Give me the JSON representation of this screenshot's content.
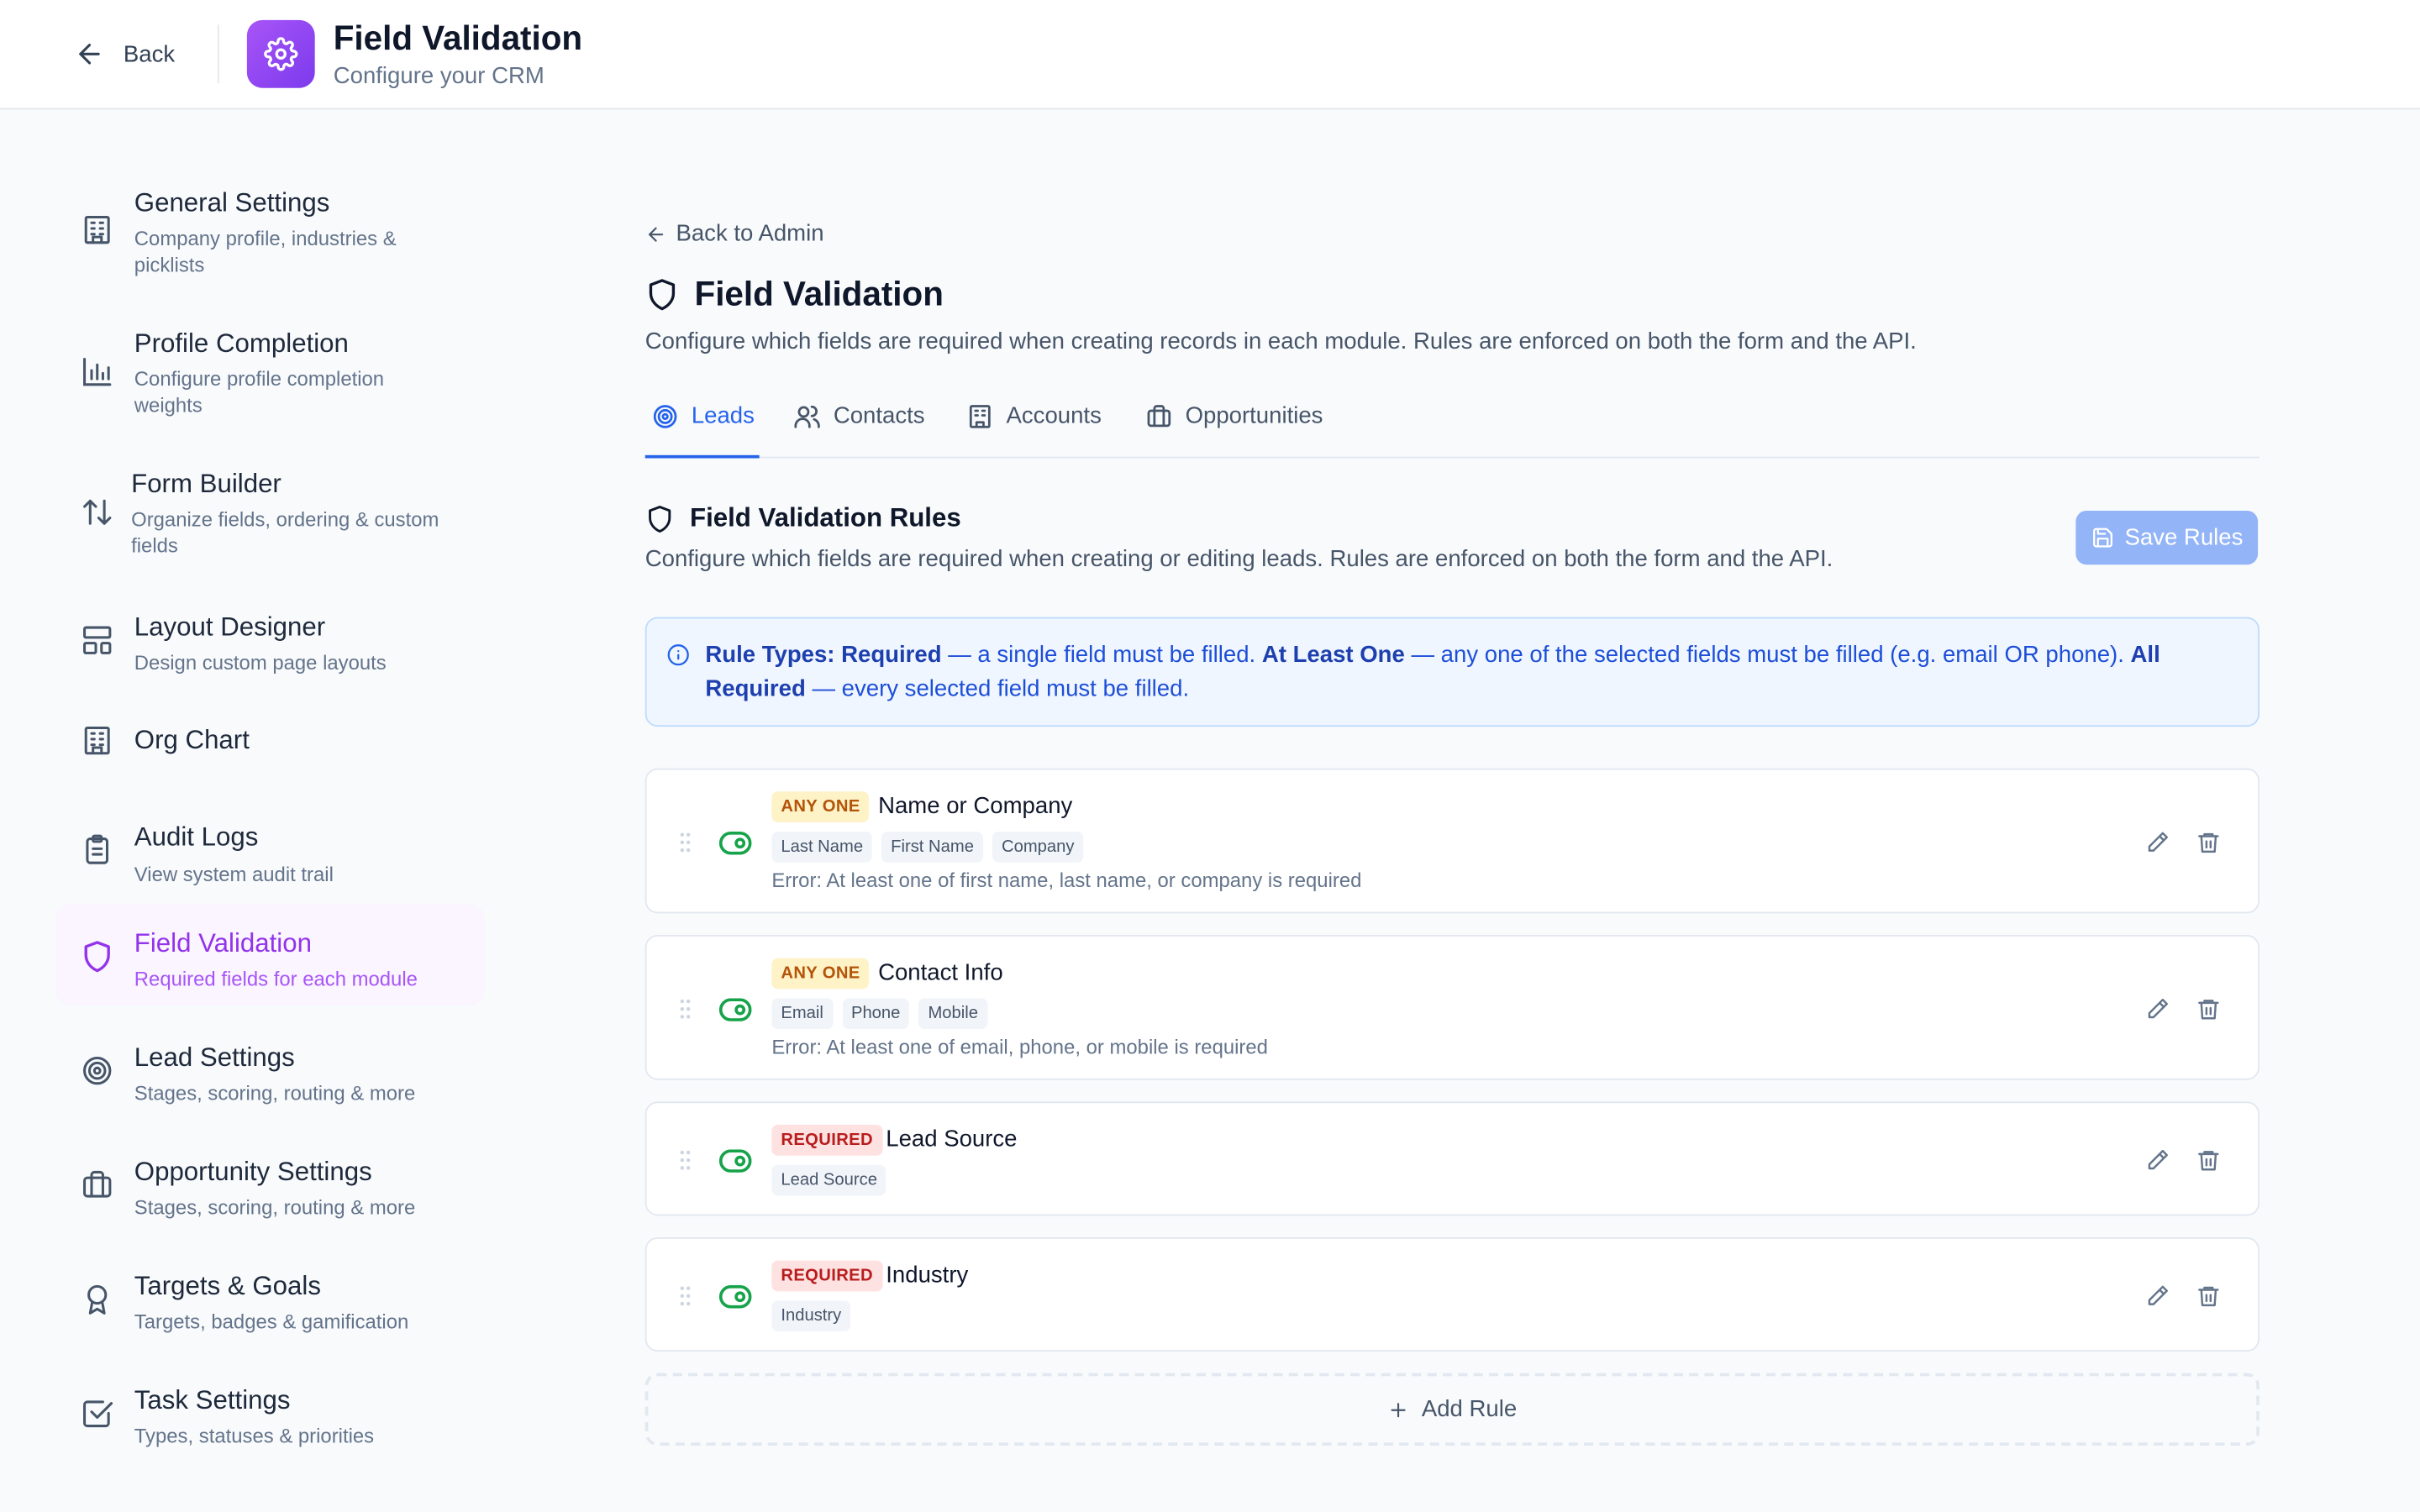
{
  "header": {
    "back_label": "Back",
    "title": "Field Validation",
    "subtitle": "Configure your CRM",
    "icon": "gear-icon"
  },
  "sidebar": {
    "items": [
      {
        "label": "General Settings",
        "desc": "Company profile, industries & picklists",
        "icon": "building-icon"
      },
      {
        "label": "Profile Completion",
        "desc": "Configure profile completion weights",
        "icon": "bar-chart-icon"
      },
      {
        "label": "Form Builder",
        "desc": "Organize fields, ordering & custom fields",
        "icon": "sort-arrows-icon"
      },
      {
        "label": "Layout Designer",
        "desc": "Design custom page layouts",
        "icon": "layout-icon"
      },
      {
        "label": "Org Chart",
        "desc": "",
        "icon": "building-icon"
      },
      {
        "label": "Audit Logs",
        "desc": "View system audit trail",
        "icon": "clipboard-icon"
      },
      {
        "label": "Field Validation",
        "desc": "Required fields for each module",
        "icon": "shield-icon",
        "active": true
      },
      {
        "label": "Lead Settings",
        "desc": "Stages, scoring, routing & more",
        "icon": "target-icon"
      },
      {
        "label": "Opportunity Settings",
        "desc": "Stages, scoring, routing & more",
        "icon": "briefcase-icon"
      },
      {
        "label": "Targets & Goals",
        "desc": "Targets, badges & gamification",
        "icon": "award-icon"
      },
      {
        "label": "Task Settings",
        "desc": "Types, statuses & priorities",
        "icon": "checkbox-icon"
      }
    ]
  },
  "main": {
    "back_admin": "Back to Admin",
    "title": "Field Validation",
    "description": "Configure which fields are required when creating records in each module. Rules are enforced on both the form and the API.",
    "tabs": [
      {
        "label": "Leads",
        "icon": "target-icon",
        "active": true
      },
      {
        "label": "Contacts",
        "icon": "users-icon"
      },
      {
        "label": "Accounts",
        "icon": "building-icon"
      },
      {
        "label": "Opportunities",
        "icon": "briefcase-icon"
      }
    ],
    "section_title": "Field Validation Rules",
    "section_desc": "Configure which fields are required when creating or editing leads. Rules are enforced on both the form and the API.",
    "save_label": "Save Rules",
    "info": {
      "t1_bold": "Rule Types: Required",
      "t1": " — a single field must be filled. ",
      "t2_bold": "At Least One",
      "t2": " — any one of the selected fields must be filled (e.g. email OR phone). ",
      "t3_bold": "All Required",
      "t3": " — every selected field must be filled."
    },
    "rules": [
      {
        "badge": "ANY ONE",
        "type": "anyone",
        "name": "Name or Company",
        "fields": [
          "Last Name",
          "First Name",
          "Company"
        ],
        "error": "Error: At least one of first name, last name, or company is required"
      },
      {
        "badge": "ANY ONE",
        "type": "anyone",
        "name": "Contact Info",
        "fields": [
          "Email",
          "Phone",
          "Mobile"
        ],
        "error": "Error: At least one of email, phone, or mobile is required"
      },
      {
        "badge": "REQUIRED",
        "type": "required",
        "name": "Lead Source",
        "fields": [
          "Lead Source"
        ],
        "error": ""
      },
      {
        "badge": "REQUIRED",
        "type": "required",
        "name": "Industry",
        "fields": [
          "Industry"
        ],
        "error": ""
      }
    ],
    "add_rule_label": "Add Rule"
  },
  "colors": {
    "accent": "#2563eb",
    "active_nav": "#9333ea",
    "toggle_on": "#16a34a"
  }
}
